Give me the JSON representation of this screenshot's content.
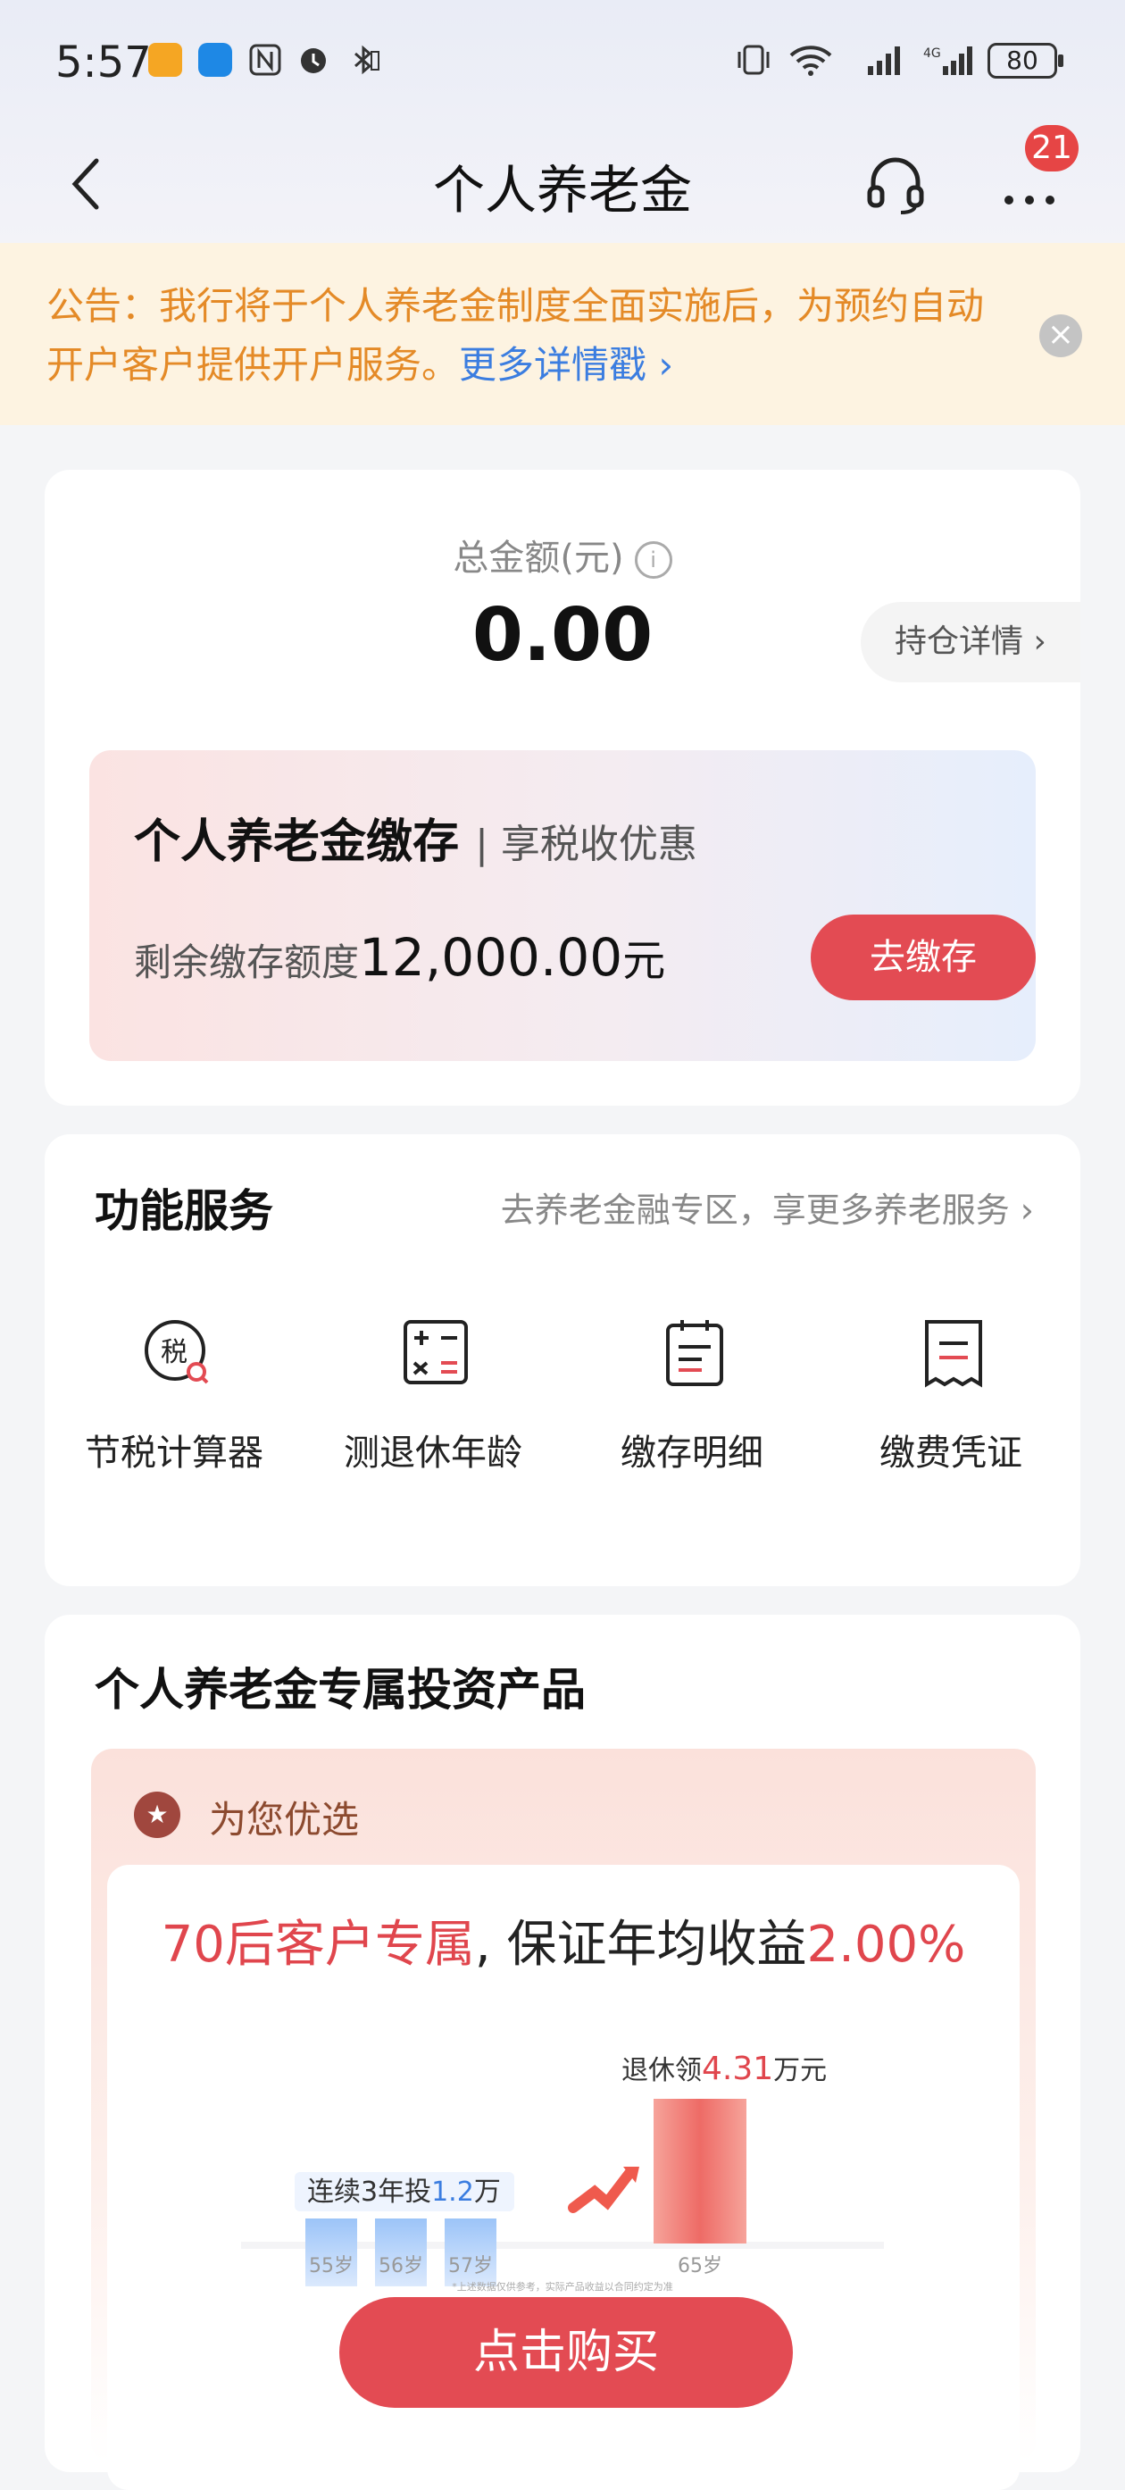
{
  "status_bar": {
    "time": "5:57",
    "battery": "80"
  },
  "nav": {
    "title": "个人养老金",
    "badge_count": "21"
  },
  "notice": {
    "text": "公告：我行将于个人养老金制度全面实施后，为预约自动开户客户提供开户服务。",
    "link": "更多详情戳 ›"
  },
  "summary": {
    "total_label": "总金额(元)",
    "total_value": "0.00",
    "holdings_button": "持仓详情 ›",
    "deposit": {
      "title": "个人养老金缴存",
      "subtitle": "| 享税收优惠",
      "remaining_label": "剩余缴存额度",
      "remaining_amount": "12,000.00",
      "unit": "元",
      "button": "去缴存"
    }
  },
  "services": {
    "title": "功能服务",
    "link": "去养老金融专区，享更多养老服务 ›",
    "items": [
      {
        "label": "节税计算器",
        "icon": "tax-calculator-icon"
      },
      {
        "label": "测退休年龄",
        "icon": "calculator-icon"
      },
      {
        "label": "缴存明细",
        "icon": "notepad-icon"
      },
      {
        "label": "缴费凭证",
        "icon": "receipt-icon"
      }
    ]
  },
  "products": {
    "title": "个人养老金专属投资产品",
    "recommend_label": "为您优选",
    "headline_red": "70后客户专属",
    "headline_mid": ", 保证年均收益",
    "headline_rate": "2.00%",
    "chart": {
      "invest_label_prefix": "连续3年投",
      "invest_amount": "1.2",
      "invest_unit": "万",
      "payout_prefix": "退休领",
      "payout_amount": "4.31",
      "payout_unit": "万元",
      "ages": [
        "55岁",
        "56岁",
        "57岁",
        "65岁"
      ],
      "footnote": "*上述数据仅供参考，实际产品收益以合同约定为准"
    },
    "buy_button": "点击购买"
  },
  "colors": {
    "accent_red": "#e34b53",
    "notice_orange": "#e48a27",
    "link_blue": "#3b7de0"
  }
}
